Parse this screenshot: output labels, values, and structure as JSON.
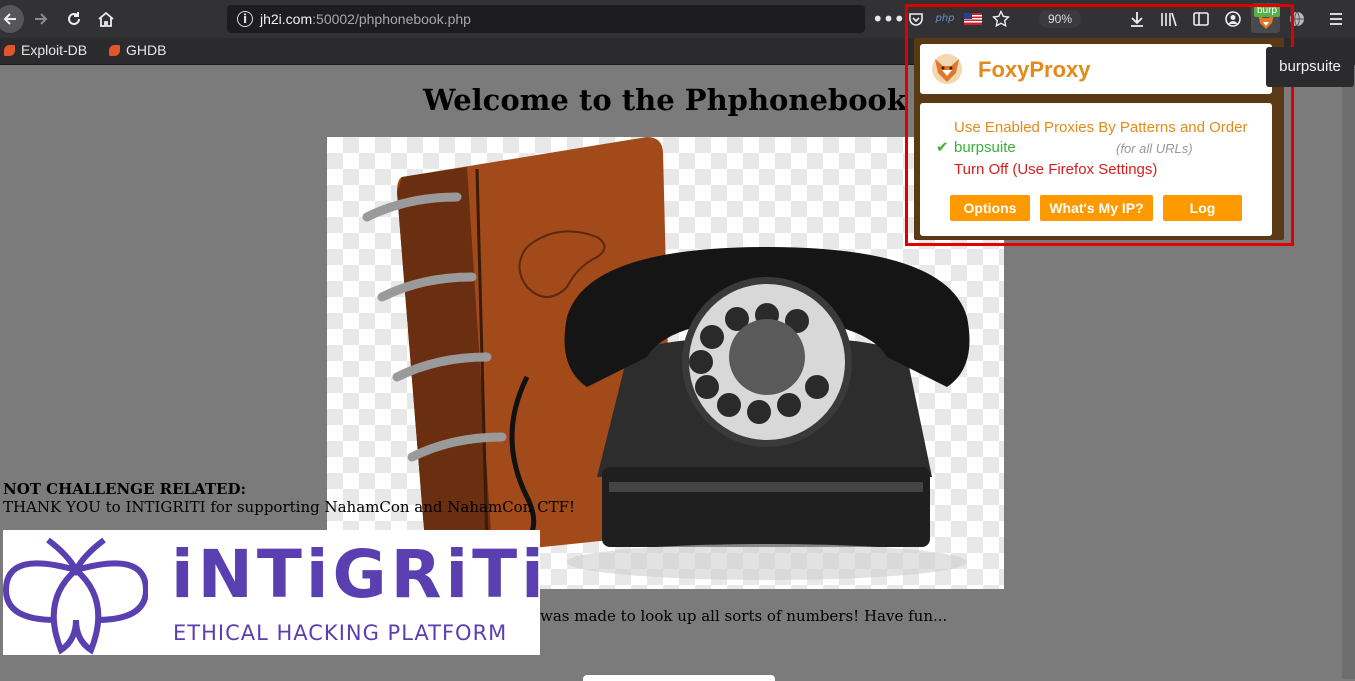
{
  "browser": {
    "url_host": "jh2i.com",
    "url_rest": ":50002/phphonebook.php",
    "zoom": "90%",
    "php_label": "php",
    "burp_badge": "burp",
    "tooltip": "burpsuite",
    "bookmarks": [
      "Exploit-DB",
      "GHDB"
    ]
  },
  "page": {
    "title": "Welcome to the Phphonebook",
    "not_related": "NOT CHALLENGE RELATED:",
    "thanks": "THANK YOU to INTIGRITI for supporting NahamCon and NahamCon CTF!",
    "description": "was made to look up all sorts of numbers! Have fun...",
    "logo_word": "iNTiGRiTi",
    "logo_tagline": "ETHICAL HACKING PLATFORM"
  },
  "foxyproxy": {
    "title": "FoxyProxy",
    "mode": "Use Enabled Proxies By Patterns and Order",
    "proxy_name": "burpsuite",
    "proxy_note": "(for all URLs)",
    "turn_off": "Turn Off (Use Firefox Settings)",
    "buttons": [
      "Options",
      "What's My IP?",
      "Log"
    ]
  },
  "colors": {
    "accent_orange": "#ff9900",
    "brand_purple": "#5a3fb0",
    "highlight_red": "#e00000"
  }
}
